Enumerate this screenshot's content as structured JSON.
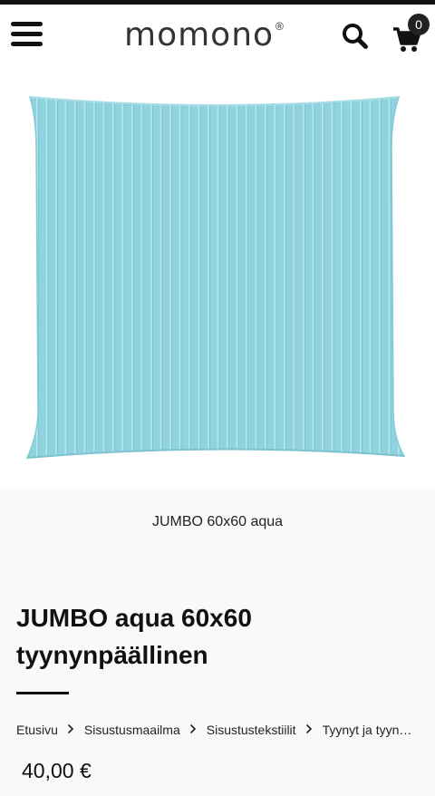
{
  "header": {
    "logo_text": "momono",
    "logo_mark": "®",
    "cart_count": "0",
    "icons": [
      "menu-icon",
      "search-icon",
      "cart-icon"
    ]
  },
  "product": {
    "image_alt": "aqua striped pillow cover",
    "image_caption": "JUMBO 60x60 aqua",
    "title": "JUMBO aqua 60x60 tyynynpäällinen",
    "price": "40,00 €",
    "colors": {
      "pillow": "#8fd3df",
      "stripe": "#b5e4ec"
    }
  },
  "breadcrumb": {
    "items": [
      "Etusivu",
      "Sisustusmaailma",
      "Sisustustekstiilit",
      "Tyynyt ja tyynynpäälliset"
    ]
  }
}
